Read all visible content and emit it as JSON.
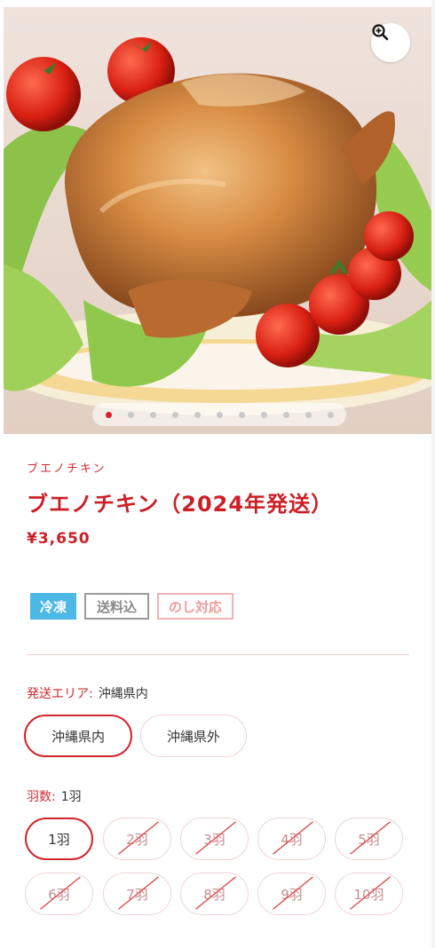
{
  "product": {
    "subname": "ブエノチキン",
    "title": "ブエノチキン（2024年発送）",
    "price": "¥3,650"
  },
  "carousel": {
    "dot_count": 11,
    "active_index": 0,
    "zoom_icon": "zoom-in-icon"
  },
  "tags": {
    "frozen": "冷凍",
    "free_shipping": "送料込",
    "noshi": "のし対応"
  },
  "colors": {
    "accent_red": "#cc1f26",
    "frozen_blue": "#4cb8e6",
    "muted_pink": "#f1d4d4"
  },
  "area": {
    "label": "発送エリア:",
    "selected_value": "沖縄県内",
    "options": [
      {
        "label": "沖縄県内",
        "selected": true,
        "disabled": false
      },
      {
        "label": "沖縄県外",
        "selected": false,
        "disabled": false
      }
    ]
  },
  "quantity": {
    "label": "羽数:",
    "selected_value": "1羽",
    "options": [
      {
        "label": "1羽",
        "selected": true,
        "disabled": false
      },
      {
        "label": "2羽",
        "selected": false,
        "disabled": true
      },
      {
        "label": "3羽",
        "selected": false,
        "disabled": true
      },
      {
        "label": "4羽",
        "selected": false,
        "disabled": true
      },
      {
        "label": "5羽",
        "selected": false,
        "disabled": true
      },
      {
        "label": "6羽",
        "selected": false,
        "disabled": true
      },
      {
        "label": "7羽",
        "selected": false,
        "disabled": true
      },
      {
        "label": "8羽",
        "selected": false,
        "disabled": true
      },
      {
        "label": "9羽",
        "selected": false,
        "disabled": true
      },
      {
        "label": "10羽",
        "selected": false,
        "disabled": true
      }
    ]
  }
}
